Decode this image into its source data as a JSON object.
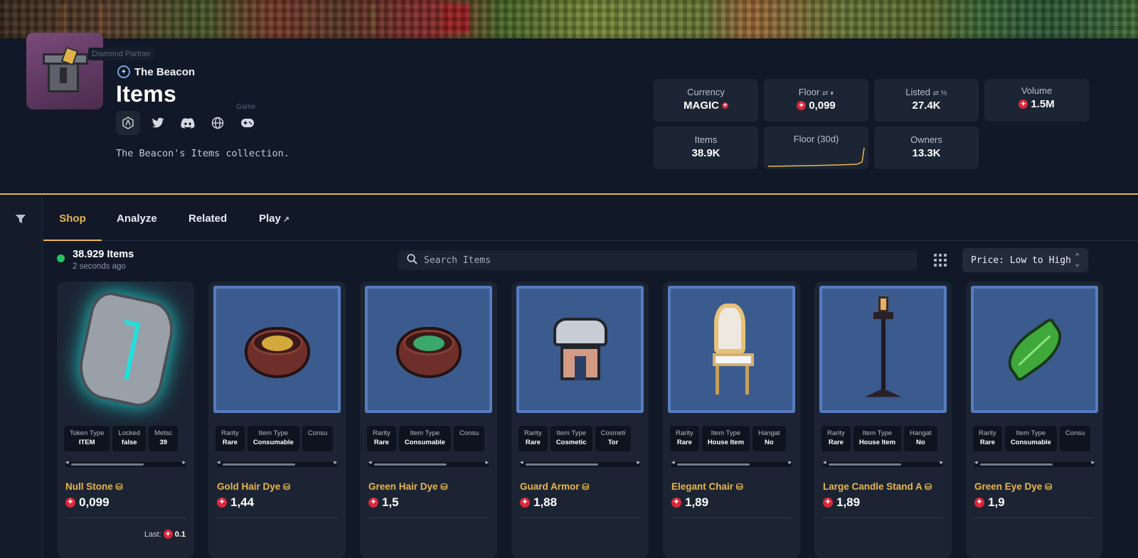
{
  "banner": {
    "tooltip": "Diamond Partner"
  },
  "collection": {
    "brand": "The Beacon",
    "title": "Items",
    "description": "The Beacon's Items collection.",
    "game_tooltip": "Game"
  },
  "socials": [
    {
      "icon": "arbitrum-icon"
    },
    {
      "icon": "twitter-icon"
    },
    {
      "icon": "discord-icon"
    },
    {
      "icon": "globe-icon"
    },
    {
      "icon": "gamepad-icon"
    }
  ],
  "stats": {
    "currency": {
      "label": "Currency",
      "value": "MAGIC"
    },
    "floor": {
      "label": "Floor",
      "value": "0,099"
    },
    "listed": {
      "label": "Listed",
      "value": "27.4K"
    },
    "volume": {
      "label": "Volume",
      "value": "1.5M"
    },
    "items": {
      "label": "Items",
      "value": "38.9K"
    },
    "floor30d": {
      "label": "Floor (30d)"
    },
    "owners": {
      "label": "Owners",
      "value": "13.3K"
    }
  },
  "tabs": [
    {
      "label": "Shop",
      "active": true
    },
    {
      "label": "Analyze",
      "active": false
    },
    {
      "label": "Related",
      "active": false
    },
    {
      "label": "Play",
      "active": false
    }
  ],
  "toolbar": {
    "count": "38.929 Items",
    "updated": "2 seconds ago",
    "search_placeholder": "Search Items",
    "sort_label": "Price: Low to High"
  },
  "cards": [
    {
      "name": "Null Stone",
      "price": "0,099",
      "last_label": "Last:",
      "last_value": "0.1",
      "attrs": [
        {
          "k": "Token Type",
          "v": "ITEM"
        },
        {
          "k": "Locked",
          "v": "false"
        },
        {
          "k": "Metsc",
          "v": "39"
        }
      ]
    },
    {
      "name": "Gold Hair Dye",
      "price": "1,44",
      "attrs": [
        {
          "k": "Rarity",
          "v": "Rare"
        },
        {
          "k": "Item Type",
          "v": "Consumable"
        },
        {
          "k": "Consu",
          "v": ""
        }
      ]
    },
    {
      "name": "Green Hair Dye",
      "price": "1,5",
      "attrs": [
        {
          "k": "Rarity",
          "v": "Rare"
        },
        {
          "k": "Item Type",
          "v": "Consumable"
        },
        {
          "k": "Consu",
          "v": ""
        }
      ]
    },
    {
      "name": "Guard Armor",
      "price": "1,88",
      "attrs": [
        {
          "k": "Rarity",
          "v": "Rare"
        },
        {
          "k": "Item Type",
          "v": "Cosmetic"
        },
        {
          "k": "Cosmeti",
          "v": "Tor"
        }
      ]
    },
    {
      "name": "Elegant Chair",
      "price": "1,89",
      "attrs": [
        {
          "k": "Rarity",
          "v": "Rare"
        },
        {
          "k": "Item Type",
          "v": "House Item"
        },
        {
          "k": "Hangat",
          "v": "No"
        }
      ]
    },
    {
      "name": "Large Candle Stand A",
      "price": "1,89",
      "attrs": [
        {
          "k": "Rarity",
          "v": "Rare"
        },
        {
          "k": "Item Type",
          "v": "House Item"
        },
        {
          "k": "Hangat",
          "v": "No"
        }
      ]
    },
    {
      "name": "Green Eye Dye",
      "price": "1,9",
      "attrs": [
        {
          "k": "Rarity",
          "v": "Rare"
        },
        {
          "k": "Item Type",
          "v": "Consumable"
        },
        {
          "k": "Consu",
          "v": ""
        }
      ]
    }
  ],
  "colors": {
    "accent": "#e8b64c",
    "magic": "#d8283a",
    "online": "#22c55e",
    "card_frame": "#567cbf"
  }
}
